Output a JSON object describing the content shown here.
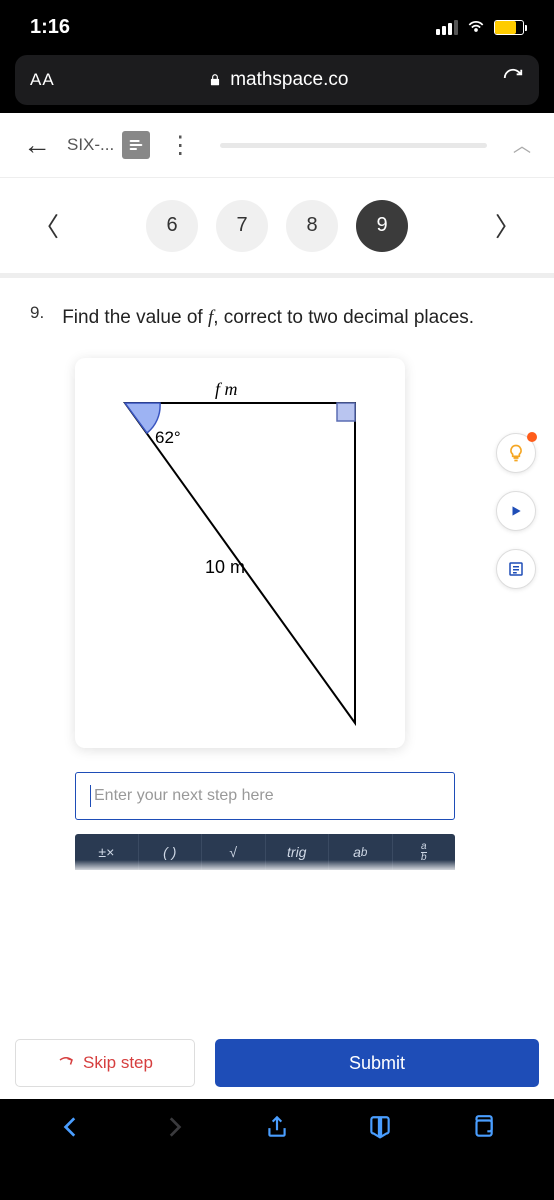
{
  "status": {
    "time": "1:16"
  },
  "url_bar": {
    "aa": "AA",
    "domain": "mathspace.co"
  },
  "topic": {
    "name": "SIX-..."
  },
  "nav": {
    "numbers": [
      "6",
      "7",
      "8",
      "9"
    ],
    "active": "9"
  },
  "question": {
    "number": "9.",
    "text_before": "Find the value of ",
    "variable": "f",
    "text_after": ", correct to two decimal places."
  },
  "diagram": {
    "top_label": "f m",
    "angle": "62°",
    "hyp_label": "10 m"
  },
  "input": {
    "placeholder": "Enter your next step here"
  },
  "keypad": {
    "paren": "( )",
    "trig": "trig",
    "b": "b",
    "a": "a"
  },
  "actions": {
    "skip": "Skip step",
    "submit": "Submit"
  }
}
